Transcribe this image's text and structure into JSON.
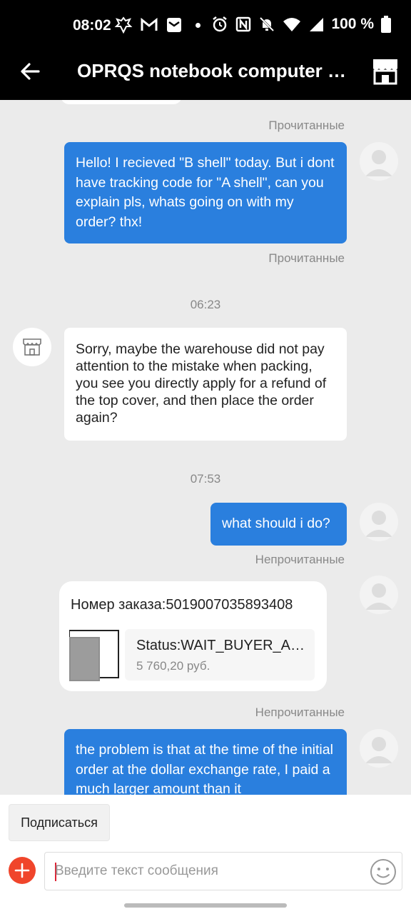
{
  "status_bar": {
    "time": "08:02",
    "battery": "100 %"
  },
  "header": {
    "back_icon": "arrow-left-icon",
    "title": "OPRQS notebook computer fr...",
    "store_icon": "store-icon"
  },
  "messages": [
    {
      "status": "Прочитанные"
    },
    {
      "direction": "out",
      "text": "Hello! I recieved \"B shell\"  today. But i dont have tracking code for \"A shell\", can you explain pls, whats going on with my order? thx!",
      "status": "Прочитанные"
    },
    {
      "timestamp": "06:23"
    },
    {
      "direction": "in",
      "text": "Sorry, maybe the warehouse did not pay attention to the mistake when packing, you see you directly apply for a refund of the top cover, and then place the order again?"
    },
    {
      "timestamp": "07:53"
    },
    {
      "direction": "out",
      "text": "what should i do?",
      "status": "Непрочитанные"
    },
    {
      "type": "order",
      "order_number": "Номер заказа:5019007035893408",
      "order_status": "Status:WAIT_BUYER_ACCEPT_GOODS",
      "price": "5 760,20 руб.",
      "status": "Непрочитанные"
    },
    {
      "direction": "out",
      "text": "the problem is that at the time of the initial order at the dollar exchange rate, I paid a much larger amount than it"
    }
  ],
  "bottom": {
    "subscribe_label": "Подписаться",
    "input_placeholder": "Введите текст сообщения",
    "plus_icon": "add-icon",
    "emoji_icon": "emoji-icon"
  },
  "colors": {
    "accent_blue": "#2a7fde",
    "plus_red": "#f0452b",
    "header_bg": "#000000",
    "chat_bg": "#ebebeb"
  }
}
